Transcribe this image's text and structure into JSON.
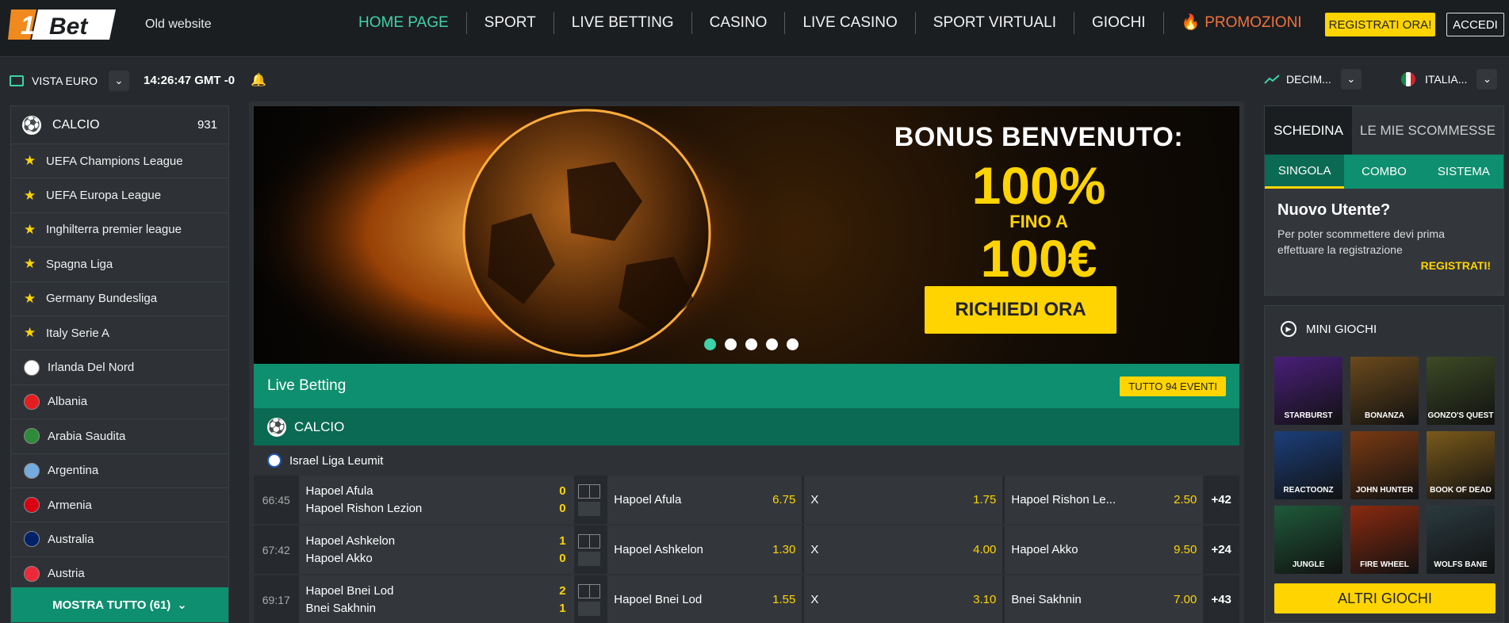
{
  "header": {
    "logo_number": "1",
    "logo_text": "Bet",
    "old_site": "Old website",
    "nav": [
      {
        "label": "HOME PAGE"
      },
      {
        "label": "SPORT"
      },
      {
        "label": "LIVE BETTING"
      },
      {
        "label": "CASINO"
      },
      {
        "label": "LIVE CASINO"
      },
      {
        "label": "SPORT VIRTUALI"
      },
      {
        "label": "GIOCHI"
      },
      {
        "label": "PROMOZIONI"
      }
    ],
    "register": "REGISTRATI ORA!",
    "login": "ACCEDI"
  },
  "subbar": {
    "view": "VISTA EURO",
    "clock": "14:26:47 GMT -0",
    "odds_format": "DECIM...",
    "language": "ITALIA..."
  },
  "sidebar": {
    "sport": "CALCIO",
    "count": "931",
    "items": [
      {
        "label": "UEFA Champions League",
        "type": "star"
      },
      {
        "label": "UEFA Europa League",
        "type": "star"
      },
      {
        "label": "Inghilterra premier league",
        "type": "star"
      },
      {
        "label": "Spagna Liga",
        "type": "star"
      },
      {
        "label": "Germany Bundesliga",
        "type": "star"
      },
      {
        "label": "Italy Serie A",
        "type": "star"
      },
      {
        "label": "Irlanda Del Nord",
        "type": "flag",
        "color": "#ffffff"
      },
      {
        "label": "Albania",
        "type": "flag",
        "color": "#e41e20"
      },
      {
        "label": "Arabia Saudita",
        "type": "flag",
        "color": "#2e8b3a"
      },
      {
        "label": "Argentina",
        "type": "flag",
        "color": "#74acdf"
      },
      {
        "label": "Armenia",
        "type": "flag",
        "color": "#d90012"
      },
      {
        "label": "Australia",
        "type": "flag",
        "color": "#012169"
      },
      {
        "label": "Austria",
        "type": "flag",
        "color": "#ed2939"
      }
    ],
    "show_all": "MOSTRA TUTTO (61)"
  },
  "banner": {
    "title": "BONUS BENVENUTO:",
    "percent": "100%",
    "upto": "FINO A",
    "amount": "100€",
    "cta": "RICHIEDI ORA",
    "slides": 5,
    "active_slide": 1
  },
  "live": {
    "title": "Live Betting",
    "all_events": "TUTTO 94 EVENTI",
    "sport": "CALCIO",
    "league": "Israel Liga Leumit",
    "matches": [
      {
        "time": "66:45",
        "home": "Hapoel Afula",
        "away": "Hapoel Rishon Lezion",
        "home_score": "0",
        "away_score": "0",
        "o1_label": "Hapoel Afula",
        "o1": "6.75",
        "ox_label": "X",
        "ox": "1.75",
        "o2_label": "Hapoel Rishon Le...",
        "o2": "2.50",
        "more": "+42"
      },
      {
        "time": "67:42",
        "home": "Hapoel Ashkelon",
        "away": "Hapoel Akko",
        "home_score": "1",
        "away_score": "0",
        "o1_label": "Hapoel Ashkelon",
        "o1": "1.30",
        "ox_label": "X",
        "ox": "4.00",
        "o2_label": "Hapoel Akko",
        "o2": "9.50",
        "more": "+24"
      },
      {
        "time": "69:17",
        "home": "Hapoel Bnei Lod",
        "away": "Bnei Sakhnin",
        "home_score": "2",
        "away_score": "1",
        "o1_label": "Hapoel Bnei Lod",
        "o1": "1.55",
        "ox_label": "X",
        "ox": "3.10",
        "o2_label": "Bnei Sakhnin",
        "o2": "7.00",
        "more": "+43"
      }
    ]
  },
  "betslip": {
    "tab_active": "SCHEDINA",
    "tab_other": "LE MIE SCOMMESSE",
    "sub_tabs": [
      "SINGOLA",
      "COMBO",
      "SISTEMA"
    ],
    "heading": "Nuovo Utente?",
    "text": "Per poter scommettere devi prima effettuare la registrazione",
    "register_link": "REGISTRATI!"
  },
  "minigames": {
    "title": "MINI GIOCHI",
    "games": [
      {
        "name": "STARBURST",
        "color": "#4a1f7a"
      },
      {
        "name": "BONANZA",
        "color": "#6b4a1c"
      },
      {
        "name": "GONZO'S QUEST",
        "color": "#3d4a25"
      },
      {
        "name": "REACTOONZ",
        "color": "#1b3f7a"
      },
      {
        "name": "JOHN HUNTER",
        "color": "#7a3a12"
      },
      {
        "name": "BOOK OF DEAD",
        "color": "#7a5a1a"
      },
      {
        "name": "JUNGLE",
        "color": "#1f5a3a"
      },
      {
        "name": "FIRE WHEEL",
        "color": "#8a2a10"
      },
      {
        "name": "WOLFS BANE",
        "color": "#2a3a3f"
      }
    ],
    "more": "ALTRI GIOCHI"
  }
}
